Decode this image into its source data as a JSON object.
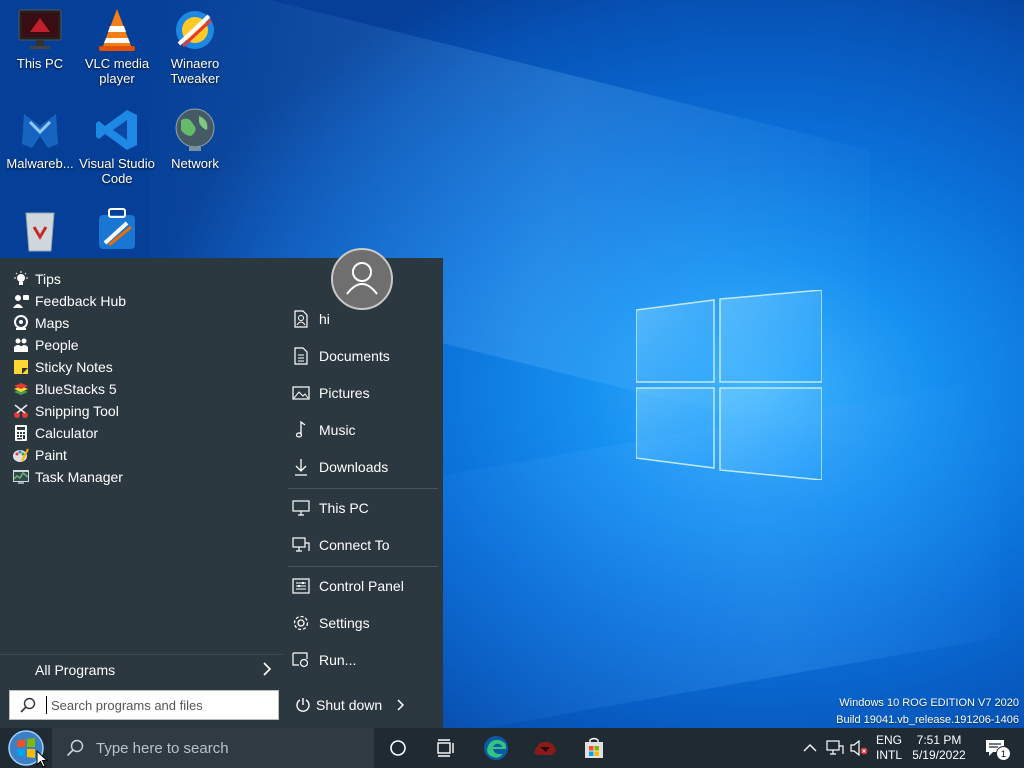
{
  "desktop": {
    "icons": [
      {
        "label": "This PC"
      },
      {
        "label": "VLC media player"
      },
      {
        "label": "Winaero Tweaker"
      },
      {
        "label": "Malwareb..."
      },
      {
        "label": "Visual Studio Code"
      },
      {
        "label": "Network"
      },
      {
        "label": ""
      },
      {
        "label": ""
      }
    ],
    "watermark": {
      "line1": "Windows 10 ROG EDITION V7 2020",
      "line2": "Build 19041.vb_release.191206-1406"
    }
  },
  "start_menu": {
    "programs": [
      {
        "label": "Tips",
        "icon": "lightbulb-icon"
      },
      {
        "label": "Feedback Hub",
        "icon": "feedback-icon"
      },
      {
        "label": "Maps",
        "icon": "maps-icon"
      },
      {
        "label": "People",
        "icon": "people-icon"
      },
      {
        "label": "Sticky Notes",
        "icon": "sticky-notes-icon"
      },
      {
        "label": "BlueStacks 5",
        "icon": "bluestacks-icon"
      },
      {
        "label": "Snipping Tool",
        "icon": "snipping-tool-icon"
      },
      {
        "label": "Calculator",
        "icon": "calculator-icon"
      },
      {
        "label": "Paint",
        "icon": "paint-icon"
      },
      {
        "label": "Task Manager",
        "icon": "task-manager-icon"
      }
    ],
    "all_programs": "All Programs",
    "search_placeholder": "Search programs and files",
    "right_items": [
      {
        "label": "hi",
        "icon": "user-folder-icon"
      },
      {
        "label": "Documents",
        "icon": "documents-icon"
      },
      {
        "label": "Pictures",
        "icon": "pictures-icon"
      },
      {
        "label": "Music",
        "icon": "music-icon"
      },
      {
        "label": "Downloads",
        "icon": "downloads-icon"
      },
      {
        "label": "This PC",
        "icon": "computer-icon"
      },
      {
        "label": "Connect To",
        "icon": "connect-icon"
      },
      {
        "label": "Control Panel",
        "icon": "control-panel-icon"
      },
      {
        "label": "Settings",
        "icon": "gear-icon"
      },
      {
        "label": "Run...",
        "icon": "run-icon"
      }
    ],
    "shutdown": "Shut down"
  },
  "taskbar": {
    "search_placeholder": "Type here to search",
    "tray": {
      "lang_top": "ENG",
      "lang_bottom": "INTL",
      "time": "7:51 PM",
      "date": "5/19/2022",
      "notification_count": "1"
    }
  },
  "colors": {
    "menu_bg": "#2c383f",
    "taskbar_bg": "#1f2a33",
    "desktop_accent": "#0a6fd8"
  }
}
